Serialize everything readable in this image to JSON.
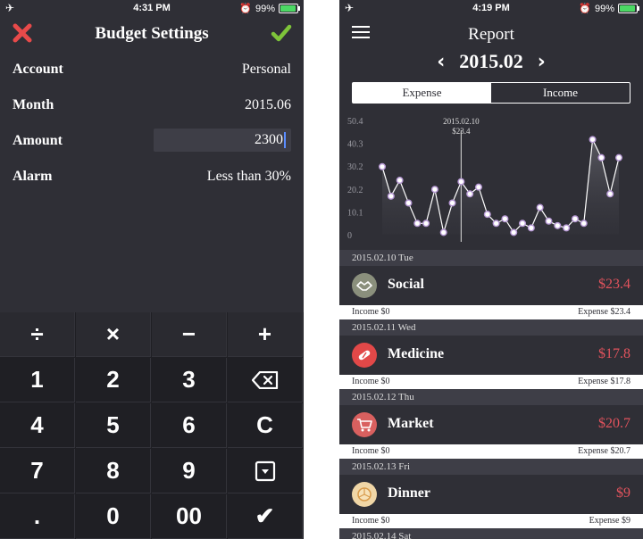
{
  "left": {
    "status": {
      "time": "4:31 PM",
      "battery": "99%"
    },
    "title": "Budget Settings",
    "rows": [
      {
        "label": "Account",
        "value": "Personal"
      },
      {
        "label": "Month",
        "value": "2015.06"
      },
      {
        "label": "Amount",
        "value": "2300"
      },
      {
        "label": "Alarm",
        "value": "Less than 30%"
      }
    ],
    "keys": [
      [
        "÷",
        "×",
        "−",
        "+"
      ],
      [
        "1",
        "2",
        "3",
        "⌫"
      ],
      [
        "4",
        "5",
        "6",
        "C"
      ],
      [
        "7",
        "8",
        "9",
        "▾"
      ],
      [
        ".",
        "0",
        "00",
        "✔"
      ]
    ],
    "colors": {
      "cancel": "#e84a4a",
      "confirm": "#7ec43a"
    }
  },
  "right": {
    "status": {
      "time": "4:19 PM",
      "battery": "99%"
    },
    "title": "Report",
    "month": "2015.02",
    "tabs": {
      "expense": "Expense",
      "income": "Income"
    },
    "entries": [
      {
        "date": "2015.02.10 Tue",
        "category": "Social",
        "amount": "$23.4",
        "income": "Income $0",
        "expense": "Expense $23.4",
        "icon": "handshake-icon",
        "color": "#8a8f7c"
      },
      {
        "date": "2015.02.11 Wed",
        "category": "Medicine",
        "amount": "$17.8",
        "income": "Income $0",
        "expense": "Expense $17.8",
        "icon": "pill-icon",
        "color": "#e24848"
      },
      {
        "date": "2015.02.12 Thu",
        "category": "Market",
        "amount": "$20.7",
        "income": "Income $0",
        "expense": "Expense $20.7",
        "icon": "cart-icon",
        "color": "#d9605f"
      },
      {
        "date": "2015.02.13 Fri",
        "category": "Dinner",
        "amount": "$9",
        "income": "Income $0",
        "expense": "Expense $9",
        "icon": "pizza-icon",
        "color": "#f0d6a6"
      },
      {
        "date": "2015.02.14 Sat"
      }
    ]
  },
  "chart_data": {
    "type": "line",
    "y_ticks": [
      "50.4",
      "40.3",
      "30.2",
      "20.2",
      "10.1",
      "0"
    ],
    "ylim": [
      0,
      50.4
    ],
    "values": [
      30,
      17,
      24,
      14,
      5,
      5,
      20,
      1,
      14,
      23.4,
      18,
      21,
      9,
      5,
      7,
      1,
      5,
      3,
      12,
      6,
      4,
      3,
      7,
      5,
      42,
      34,
      18,
      34
    ],
    "highlight_index": 9,
    "highlight_label": [
      "2015.02.10",
      "$23.4"
    ]
  }
}
